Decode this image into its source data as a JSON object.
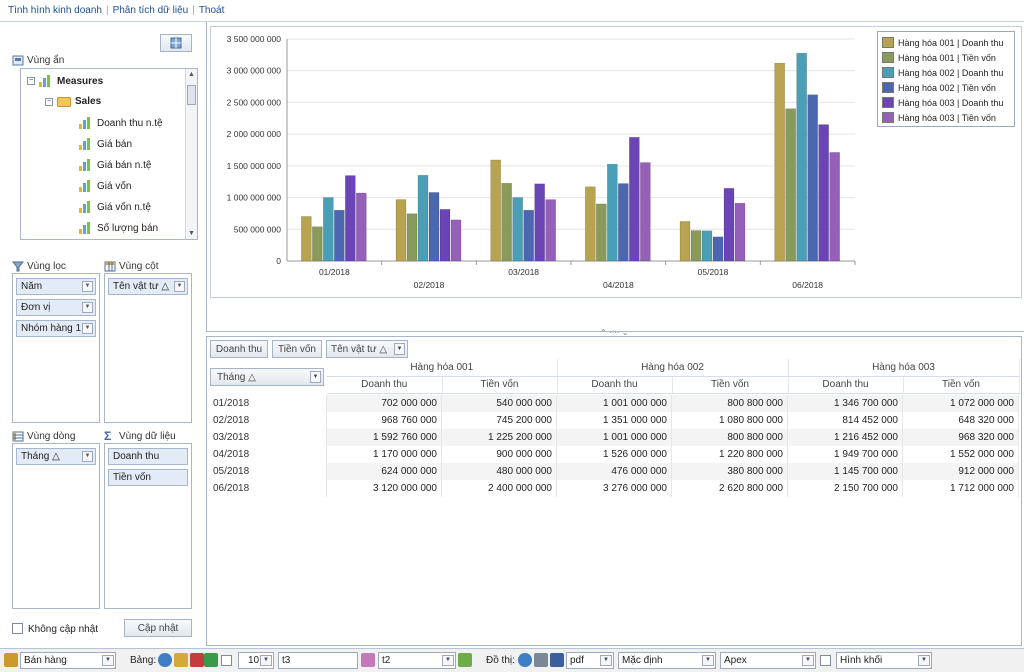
{
  "menu": {
    "items": [
      "Tình hình kinh doanh",
      "Phân tích dữ liệu",
      "Thoát"
    ]
  },
  "left": {
    "hidden_area": "Vùng ẩn",
    "tree": {
      "root": "Measures",
      "folder": "Sales",
      "items": [
        "Doanh thu n.tệ",
        "Giá bán",
        "Giá bán n.tệ",
        "Giá vốn",
        "Giá vốn n.tệ",
        "Số lượng bán"
      ]
    },
    "filter_area": {
      "title": "Vùng lọc",
      "chips": [
        "Năm",
        "Đơn vị",
        "Nhóm hàng 1"
      ]
    },
    "column_area": {
      "title": "Vùng cột",
      "chips": [
        "Tên vật tư △"
      ]
    },
    "row_area": {
      "title": "Vùng dòng",
      "chips": [
        "Tháng △"
      ]
    },
    "data_area": {
      "title": "Vùng dữ liệu",
      "chips": [
        "Doanh thu",
        "Tiền vốn"
      ]
    },
    "no_update_label": "Không cập nhật",
    "update_button": "Cập nhật"
  },
  "chart_data": {
    "type": "bar",
    "categories": [
      "01/2018",
      "02/2018",
      "03/2018",
      "04/2018",
      "05/2018",
      "06/2018"
    ],
    "ylim": [
      0,
      3500000000
    ],
    "yticks": [
      "0",
      "500 000 000",
      "1 000 000 000",
      "1 500 000 000",
      "2 000 000 000",
      "2 500 000 000",
      "3 000 000 000",
      "3 500 000 000"
    ],
    "legend_position": "top-right",
    "series": [
      {
        "name": "Hàng hóa 001 | Doanh thu",
        "color": "#b7a350",
        "values": [
          702000000,
          968760000,
          1592760000,
          1170000000,
          624000000,
          3120000000
        ]
      },
      {
        "name": "Hàng hóa 001 | Tiền vốn",
        "color": "#8a9a5b",
        "values": [
          540000000,
          745200000,
          1225200000,
          900000000,
          480000000,
          2400000000
        ]
      },
      {
        "name": "Hàng hóa 002 | Doanh thu",
        "color": "#4a9fb7",
        "values": [
          1001000000,
          1351000000,
          1001000000,
          1526000000,
          476000000,
          3276000000
        ]
      },
      {
        "name": "Hàng hóa 002 | Tiền vốn",
        "color": "#4b67b0",
        "values": [
          800800000,
          1080800000,
          800800000,
          1220800000,
          380800000,
          2620800000
        ]
      },
      {
        "name": "Hàng hóa 003 | Doanh thu",
        "color": "#6b45b5",
        "values": [
          1346700000,
          814452000,
          1216452000,
          1949700000,
          1145700000,
          2150700000
        ]
      },
      {
        "name": "Hàng hóa 003 | Tiền vốn",
        "color": "#9460b8",
        "values": [
          1072000000,
          648320000,
          968320000,
          1552000000,
          912000000,
          1712000000
        ]
      }
    ]
  },
  "grid": {
    "data_buttons": [
      "Doanh thu",
      "Tiền vốn"
    ],
    "column_field": "Tên vật tư △",
    "row_field": "Tháng △",
    "groups": [
      "Hàng hóa 001",
      "Hàng hóa 002",
      "Hàng hóa 003"
    ],
    "subheaders": [
      "Doanh thu",
      "Tiền vốn",
      "Doanh thu",
      "Tiền vốn",
      "Doanh thu",
      "Tiền vốn"
    ],
    "rows": [
      {
        "label": "01/2018",
        "cells": [
          "702 000 000",
          "540 000 000",
          "1 001 000 000",
          "800 800 000",
          "1 346 700 000",
          "1 072 000 000"
        ]
      },
      {
        "label": "02/2018",
        "cells": [
          "968 760 000",
          "745 200 000",
          "1 351 000 000",
          "1 080 800 000",
          "814 452 000",
          "648 320 000"
        ]
      },
      {
        "label": "03/2018",
        "cells": [
          "1 592 760 000",
          "1 225 200 000",
          "1 001 000 000",
          "800 800 000",
          "1 216 452 000",
          "968 320 000"
        ]
      },
      {
        "label": "04/2018",
        "cells": [
          "1 170 000 000",
          "900 000 000",
          "1 526 000 000",
          "1 220 800 000",
          "1 949 700 000",
          "1 552 000 000"
        ]
      },
      {
        "label": "05/2018",
        "cells": [
          "624 000 000",
          "480 000 000",
          "476 000 000",
          "380 800 000",
          "1 145 700 000",
          "912 000 000"
        ]
      },
      {
        "label": "06/2018",
        "cells": [
          "3 120 000 000",
          "2 400 000 000",
          "3 276 000 000",
          "2 620 800 000",
          "2 150 700 000",
          "1 712 000 000"
        ]
      }
    ]
  },
  "statusbar": {
    "report": "Bán hàng",
    "table_label": "Bảng:",
    "page_size": "10",
    "table_name": "t3",
    "second_name": "t2",
    "chart_label": "Đồ thị:",
    "export_format": "pdf",
    "style": "Mặc định",
    "theme": "Apex",
    "shape": "Hình khối"
  }
}
